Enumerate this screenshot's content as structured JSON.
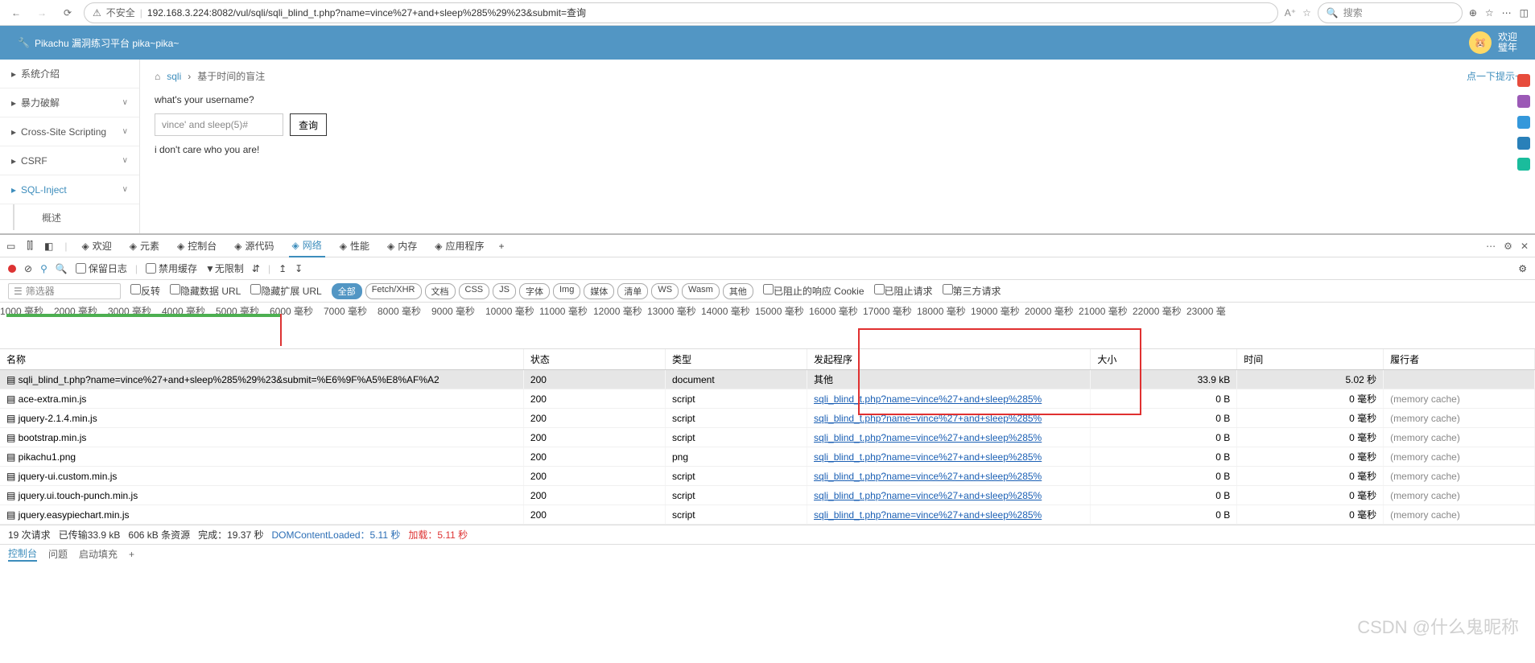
{
  "browser": {
    "insecure": "不安全",
    "url": "192.168.3.224:8082/vul/sqli/sqli_blind_t.php?name=vince%27+and+sleep%285%29%23&submit=查询",
    "search_placeholder": "搜索"
  },
  "app": {
    "title": "Pikachu 漏洞练习平台 pika~pika~",
    "welcome1": "欢迎",
    "welcome2": "璧年"
  },
  "sidebar": {
    "items": [
      {
        "icon": "tags-icon",
        "label": "系统介绍",
        "exp": false
      },
      {
        "icon": "lock-icon",
        "label": "暴力破解",
        "exp": true
      },
      {
        "icon": "code-icon",
        "label": "Cross-Site Scripting",
        "exp": true
      },
      {
        "icon": "refresh-icon",
        "label": "CSRF",
        "exp": true
      },
      {
        "icon": "plane-icon",
        "label": "SQL-Inject",
        "exp": true,
        "active": true
      }
    ],
    "sub": "概述"
  },
  "content": {
    "home_icon": "home-icon",
    "bc_link": "sqli",
    "bc_sep": "›",
    "bc_current": "基于时间的盲注",
    "hint": "点一下提示~",
    "prompt": "what's your username?",
    "input_value": "vince' and sleep(5)#",
    "btn": "查询",
    "msg": "i don't care who you are!"
  },
  "devtools": {
    "tabs": [
      {
        "icon": "heart-icon",
        "label": "欢迎"
      },
      {
        "icon": "code-icon",
        "label": "元素"
      },
      {
        "icon": "console-icon",
        "label": "控制台"
      },
      {
        "icon": "source-icon",
        "label": "源代码"
      },
      {
        "icon": "network-icon",
        "label": "网络",
        "active": true
      },
      {
        "icon": "perf-icon",
        "label": "性能"
      },
      {
        "icon": "memory-icon",
        "label": "内存"
      },
      {
        "icon": "app-icon",
        "label": "应用程序"
      }
    ],
    "toolbar": {
      "preserve": "保留日志",
      "disable_cache": "禁用缓存",
      "throttle": "无限制"
    },
    "filter": {
      "placeholder": "筛选器",
      "invert": "反转",
      "hide_data": "隐藏数据 URL",
      "hide_ext": "隐藏扩展 URL",
      "pills": [
        "全部",
        "Fetch/XHR",
        "文档",
        "CSS",
        "JS",
        "字体",
        "Img",
        "媒体",
        "清单",
        "WS",
        "Wasm",
        "其他"
      ],
      "blocked_cookie": "已阻止的响应 Cookie",
      "blocked_req": "已阻止请求",
      "third_party": "第三方请求"
    },
    "timeline_ticks": [
      "1000 毫秒",
      "2000 毫秒",
      "3000 毫秒",
      "4000 毫秒",
      "5000 毫秒",
      "6000 毫秒",
      "7000 毫秒",
      "8000 毫秒",
      "9000 毫秒",
      "10000 毫秒",
      "11000 毫秒",
      "12000 毫秒",
      "13000 毫秒",
      "14000 毫秒",
      "15000 毫秒",
      "16000 毫秒",
      "17000 毫秒",
      "18000 毫秒",
      "19000 毫秒",
      "20000 毫秒",
      "21000 毫秒",
      "22000 毫秒",
      "23000 毫"
    ],
    "headers": {
      "name": "名称",
      "status": "状态",
      "type": "类型",
      "initiator": "发起程序",
      "size": "大小",
      "time": "时间",
      "perf": "履行者"
    },
    "rows": [
      {
        "name": "sqli_blind_t.php?name=vince%27+and+sleep%285%29%23&submit=%E6%9F%A5%E8%AF%A2",
        "status": "200",
        "type": "document",
        "initiator": "其他",
        "size": "33.9 kB",
        "time": "5.02 秒",
        "perf": "",
        "hl": true,
        "link": false
      },
      {
        "name": "ace-extra.min.js",
        "status": "200",
        "type": "script",
        "initiator": "sqli_blind_t.php?name=vince%27+and+sleep%285%",
        "size": "0 B",
        "time": "0 毫秒",
        "perf": "(memory cache)",
        "link": true
      },
      {
        "name": "jquery-2.1.4.min.js",
        "status": "200",
        "type": "script",
        "initiator": "sqli_blind_t.php?name=vince%27+and+sleep%285%",
        "size": "0 B",
        "time": "0 毫秒",
        "perf": "(memory cache)",
        "link": true
      },
      {
        "name": "bootstrap.min.js",
        "status": "200",
        "type": "script",
        "initiator": "sqli_blind_t.php?name=vince%27+and+sleep%285%",
        "size": "0 B",
        "time": "0 毫秒",
        "perf": "(memory cache)",
        "link": true
      },
      {
        "name": "pikachu1.png",
        "status": "200",
        "type": "png",
        "initiator": "sqli_blind_t.php?name=vince%27+and+sleep%285%",
        "size": "0 B",
        "time": "0 毫秒",
        "perf": "(memory cache)",
        "link": true
      },
      {
        "name": "jquery-ui.custom.min.js",
        "status": "200",
        "type": "script",
        "initiator": "sqli_blind_t.php?name=vince%27+and+sleep%285%",
        "size": "0 B",
        "time": "0 毫秒",
        "perf": "(memory cache)",
        "link": true
      },
      {
        "name": "jquery.ui.touch-punch.min.js",
        "status": "200",
        "type": "script",
        "initiator": "sqli_blind_t.php?name=vince%27+and+sleep%285%",
        "size": "0 B",
        "time": "0 毫秒",
        "perf": "(memory cache)",
        "link": true
      },
      {
        "name": "jquery.easypiechart.min.js",
        "status": "200",
        "type": "script",
        "initiator": "sqli_blind_t.php?name=vince%27+and+sleep%285%",
        "size": "0 B",
        "time": "0 毫秒",
        "perf": "(memory cache)",
        "link": true
      }
    ],
    "status": {
      "requests": "19 次请求",
      "transferred": "已传输33.9 kB",
      "resources": "606 kB 条资源",
      "finish": "完成：19.37 秒",
      "dcl_label": "DOMContentLoaded：",
      "dcl": "5.11 秒",
      "load_label": "加载：",
      "load": "5.11 秒"
    },
    "bottom_tabs": [
      "控制台",
      "问题",
      "启动填充"
    ]
  },
  "watermark": "CSDN @什么鬼昵称"
}
